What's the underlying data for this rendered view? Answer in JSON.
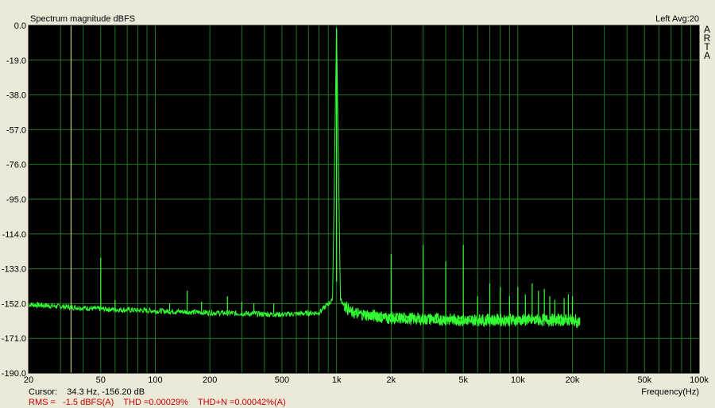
{
  "header": {
    "title": "Spectrum magnitude dBFS",
    "channel_avg": "Left  Avg:20",
    "brand_letters": [
      "A",
      "R",
      "T",
      "A"
    ]
  },
  "footer": {
    "cursor": "Cursor:    34.3 Hz, -156.20 dB",
    "stats": "RMS =   -1.5 dBFS(A)    THD =0.00029%    THD+N =0.00042%(A)",
    "xlabel": "Frequency(Hz)"
  },
  "colors": {
    "plot_background": "#000000",
    "grid": "#1f7a1f",
    "trace": "#33ff33",
    "cursor": "#c8c88a",
    "stats_text": "#c00000"
  },
  "chart_data": {
    "type": "line",
    "title": "Spectrum magnitude dBFS",
    "xlabel": "Frequency(Hz)",
    "ylabel": "",
    "xscale": "log",
    "xlim": [
      20,
      100000
    ],
    "ylim": [
      -190,
      0
    ],
    "x_ticks": [
      {
        "v": 20,
        "label": "20"
      },
      {
        "v": 50,
        "label": "50"
      },
      {
        "v": 100,
        "label": "100"
      },
      {
        "v": 200,
        "label": "200"
      },
      {
        "v": 500,
        "label": "500"
      },
      {
        "v": 1000,
        "label": "1k"
      },
      {
        "v": 2000,
        "label": "2k"
      },
      {
        "v": 5000,
        "label": "5k"
      },
      {
        "v": 10000,
        "label": "10k"
      },
      {
        "v": 20000,
        "label": "20k"
      },
      {
        "v": 50000,
        "label": "50k"
      },
      {
        "v": 100000,
        "label": "100k"
      }
    ],
    "y_ticks": [
      {
        "v": 0,
        "label": "0.0"
      },
      {
        "v": -19,
        "label": "-19.0"
      },
      {
        "v": -38,
        "label": "-38.0"
      },
      {
        "v": -57,
        "label": "-57.0"
      },
      {
        "v": -76,
        "label": "-76.0"
      },
      {
        "v": -95,
        "label": "-95.0"
      },
      {
        "v": -114,
        "label": "-114.0"
      },
      {
        "v": -133,
        "label": "-133.0"
      },
      {
        "v": -152,
        "label": "-152.0"
      },
      {
        "v": -171,
        "label": "-171.0"
      },
      {
        "v": -190,
        "label": "-190.0"
      }
    ],
    "grid": true,
    "cursor_x": 34.3,
    "series": [
      {
        "floor": [
          [
            20,
            -152.5
          ],
          [
            50,
            -155
          ],
          [
            100,
            -156
          ],
          [
            200,
            -157
          ],
          [
            500,
            -158
          ],
          [
            800,
            -157
          ],
          [
            950,
            -150
          ],
          [
            1000,
            -1.5
          ],
          [
            1050,
            -150
          ],
          [
            1200,
            -157
          ],
          [
            2000,
            -160
          ],
          [
            5000,
            -161
          ],
          [
            10000,
            -161
          ],
          [
            20000,
            -161
          ],
          [
            22000,
            -162
          ]
        ],
        "spurs": [
          [
            50,
            -127
          ],
          [
            150,
            -145
          ],
          [
            250,
            -148
          ],
          [
            60,
            -150
          ],
          [
            120,
            -152
          ],
          [
            180,
            -151
          ],
          [
            300,
            -151
          ],
          [
            350,
            -152
          ],
          [
            450,
            -152
          ],
          [
            2000,
            -125
          ],
          [
            3000,
            -120
          ],
          [
            4000,
            -129
          ],
          [
            5000,
            -120
          ],
          [
            6000,
            -148
          ],
          [
            7000,
            -141
          ],
          [
            8000,
            -143
          ],
          [
            9000,
            -148
          ],
          [
            10000,
            -143
          ],
          [
            11000,
            -147
          ],
          [
            12000,
            -141
          ],
          [
            13000,
            -145
          ],
          [
            14000,
            -144
          ],
          [
            15000,
            -148
          ],
          [
            16000,
            -150
          ],
          [
            18000,
            -149
          ],
          [
            19000,
            -147
          ],
          [
            20000,
            -148
          ]
        ]
      }
    ]
  }
}
